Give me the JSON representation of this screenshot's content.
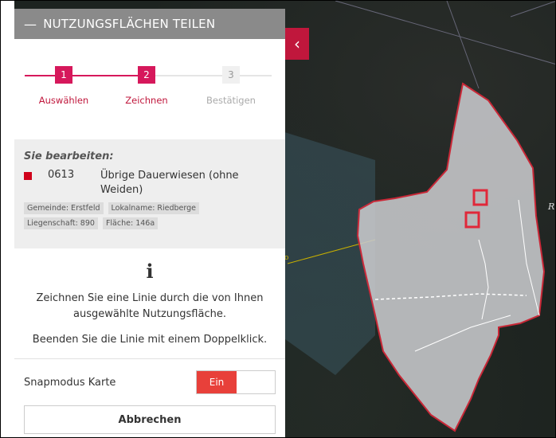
{
  "panel": {
    "title": "NUTZUNGSFLÄCHEN TEILEN",
    "steps": [
      {
        "number": "1",
        "label": "Auswählen",
        "state": "done"
      },
      {
        "number": "2",
        "label": "Zeichnen",
        "state": "active"
      },
      {
        "number": "3",
        "label": "Bestätigen",
        "state": "inactive"
      }
    ],
    "editing": {
      "heading": "Sie bearbeiten:",
      "code": "0613",
      "name": "Übrige Dauerwiesen (ohne Weiden)",
      "tags": [
        "Gemeinde: Erstfeld",
        "Lokalname: Riedberge",
        "Liegenschaft: 890",
        "Fläche: 146a"
      ]
    },
    "info": {
      "icon": "i",
      "text": "Zeichnen Sie eine Linie durch die von Ihnen ausgewählte Nutzungsfläche.",
      "text2": "Beenden Sie die Linie mit einem Doppelklick."
    },
    "snap": {
      "label": "Snapmodus Karte",
      "on_label": "Ein"
    },
    "cancel_label": "Abbrechen"
  },
  "map": {
    "label_right": "R",
    "label_left": "o"
  },
  "colors": {
    "accent": "#d6185b",
    "header": "#8a8a8a",
    "polygon_stroke": "#e0283a"
  }
}
